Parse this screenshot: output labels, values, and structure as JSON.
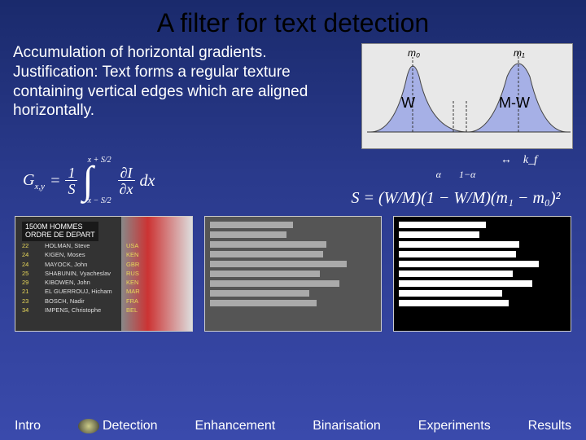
{
  "title": "A filter for text detection",
  "intro_text": "Accumulation of horizontal gradients. Justification: Text forms a regular texture containing vertical edges which are aligned horizontally.",
  "diagram": {
    "m0": "m₀",
    "m1": "m₁",
    "w": "W",
    "mw": "M-W",
    "kf": "k_f",
    "alpha": "α",
    "one_minus_alpha": "1−α"
  },
  "formula_left": {
    "lhs": "G",
    "lhs_sub": "x,y",
    "eq": "=",
    "frac1_top": "1",
    "frac1_bot": "S",
    "int_upper": "x + S/2",
    "int_lower": "x − S/2",
    "frac2_top": "∂I",
    "frac2_bot": "∂x",
    "dx": "dx"
  },
  "formula_right": "S = (W/M)(1 − W/M)(m₁ − m₀)²",
  "video_panel": {
    "title1": "1500M HOMMES",
    "title2": "ORDRE DE DEPART",
    "rows": [
      {
        "n": "22",
        "name": "HOLMAN, Steve",
        "cc": "USA"
      },
      {
        "n": "24",
        "name": "KIGEN, Moses",
        "cc": "KEN"
      },
      {
        "n": "24",
        "name": "MAYOCK, John",
        "cc": "GBR"
      },
      {
        "n": "25",
        "name": "SHABUNIN, Vyacheslav",
        "cc": "RUS"
      },
      {
        "n": "29",
        "name": "KIBOWEN, John",
        "cc": "KEN"
      },
      {
        "n": "21",
        "name": "EL GUERROUJ, Hicham",
        "cc": "MAR"
      },
      {
        "n": "23",
        "name": "BOSCH, Nadir",
        "cc": "FRA"
      },
      {
        "n": "34",
        "name": "IMPENS, Christophe",
        "cc": "BEL"
      }
    ]
  },
  "nav": {
    "intro": "Intro",
    "detection": "Detection",
    "enhancement": "Enhancement",
    "binarisation": "Binarisation",
    "experiments": "Experiments",
    "results": "Results"
  }
}
